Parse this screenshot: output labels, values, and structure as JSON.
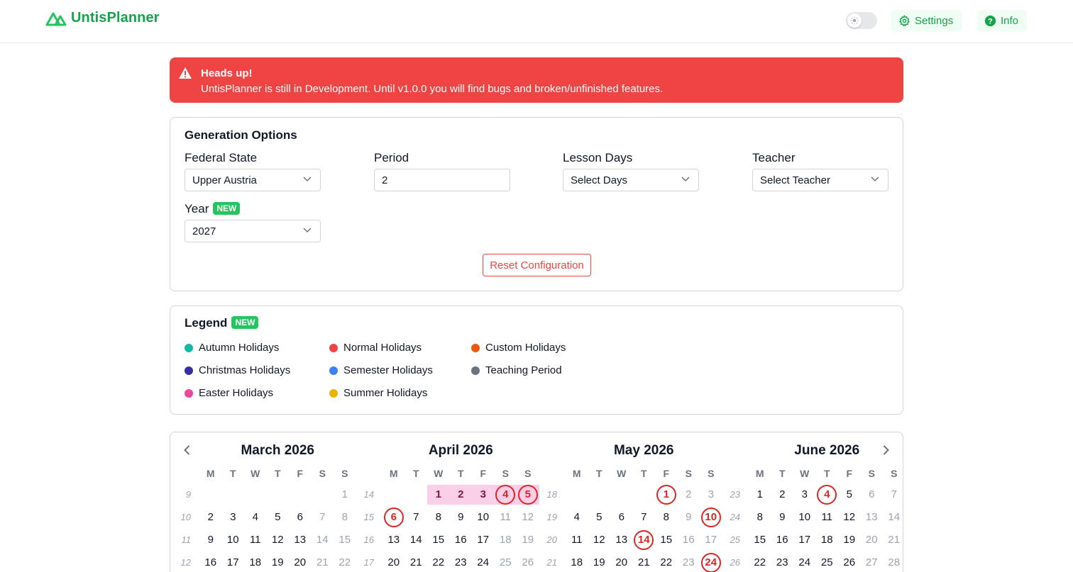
{
  "header": {
    "brand": "UntisPlanner",
    "settings_label": "Settings",
    "info_label": "Info"
  },
  "alert": {
    "title": "Heads up!",
    "message": "UntisPlanner is still in Development. Until v1.0.0 you will find bugs and broken/unfinished features."
  },
  "generation": {
    "title": "Generation Options",
    "federal_state": {
      "label": "Federal State",
      "value": "Upper Austria"
    },
    "period": {
      "label": "Period",
      "value": "2"
    },
    "lesson_days": {
      "label": "Lesson Days",
      "value": "Select Days"
    },
    "teacher": {
      "label": "Teacher",
      "value": "Select Teacher"
    },
    "year": {
      "label": "Year",
      "badge": "NEW",
      "value": "2027"
    },
    "reset_label": "Reset Configuration"
  },
  "legend": {
    "title": "Legend",
    "badge": "NEW",
    "items": [
      {
        "label": "Autumn Holidays",
        "color": "#14b8a6"
      },
      {
        "label": "Christmas Holidays",
        "color": "#3730a3"
      },
      {
        "label": "Easter Holidays",
        "color": "#ec4899"
      },
      {
        "label": "Normal Holidays",
        "color": "#ef4444"
      },
      {
        "label": "Semester Holidays",
        "color": "#3b82f6"
      },
      {
        "label": "Summer Holidays",
        "color": "#eab308"
      },
      {
        "label": "Custom Holidays",
        "color": "#ea580c"
      },
      {
        "label": "Teaching Period",
        "color": "#6b7280"
      }
    ]
  },
  "calendar": {
    "weekday_headers": [
      "M",
      "T",
      "W",
      "T",
      "F",
      "S",
      "S"
    ],
    "months": [
      {
        "title": "March 2026",
        "weeks": [
          {
            "wk": "9",
            "days": [
              "",
              "",
              "",
              "",
              "",
              "",
              "1"
            ]
          },
          {
            "wk": "10",
            "days": [
              "2",
              "3",
              "4",
              "5",
              "6",
              "7",
              "8"
            ]
          },
          {
            "wk": "11",
            "days": [
              "9",
              "10",
              "11",
              "12",
              "13",
              "14",
              "15"
            ]
          },
          {
            "wk": "12",
            "days": [
              "16",
              "17",
              "18",
              "19",
              "20",
              "21",
              "22"
            ]
          }
        ],
        "easter": [],
        "rings": []
      },
      {
        "title": "April 2026",
        "weeks": [
          {
            "wk": "14",
            "days": [
              "",
              "",
              "1",
              "2",
              "3",
              "4",
              "5"
            ]
          },
          {
            "wk": "15",
            "days": [
              "6",
              "7",
              "8",
              "9",
              "10",
              "11",
              "12"
            ]
          },
          {
            "wk": "16",
            "days": [
              "13",
              "14",
              "15",
              "16",
              "17",
              "18",
              "19"
            ]
          },
          {
            "wk": "17",
            "days": [
              "20",
              "21",
              "22",
              "23",
              "24",
              "25",
              "26"
            ]
          }
        ],
        "easter": [
          "1",
          "2",
          "3",
          "4",
          "5"
        ],
        "rings": [
          "4",
          "5",
          "6"
        ]
      },
      {
        "title": "May 2026",
        "weeks": [
          {
            "wk": "18",
            "days": [
              "",
              "",
              "",
              "",
              "1",
              "2",
              "3"
            ]
          },
          {
            "wk": "19",
            "days": [
              "4",
              "5",
              "6",
              "7",
              "8",
              "9",
              "10"
            ]
          },
          {
            "wk": "20",
            "days": [
              "11",
              "12",
              "13",
              "14",
              "15",
              "16",
              "17"
            ]
          },
          {
            "wk": "21",
            "days": [
              "18",
              "19",
              "20",
              "21",
              "22",
              "23",
              "24"
            ]
          }
        ],
        "easter": [],
        "rings": [
          "1",
          "10",
          "14",
          "24"
        ]
      },
      {
        "title": "June 2026",
        "weeks": [
          {
            "wk": "23",
            "days": [
              "1",
              "2",
              "3",
              "4",
              "5",
              "6",
              "7"
            ]
          },
          {
            "wk": "24",
            "days": [
              "8",
              "9",
              "10",
              "11",
              "12",
              "13",
              "14"
            ]
          },
          {
            "wk": "25",
            "days": [
              "15",
              "16",
              "17",
              "18",
              "19",
              "20",
              "21"
            ]
          },
          {
            "wk": "26",
            "days": [
              "22",
              "23",
              "24",
              "25",
              "26",
              "27",
              "28"
            ]
          }
        ],
        "easter": [],
        "rings": [
          "4"
        ]
      }
    ]
  }
}
